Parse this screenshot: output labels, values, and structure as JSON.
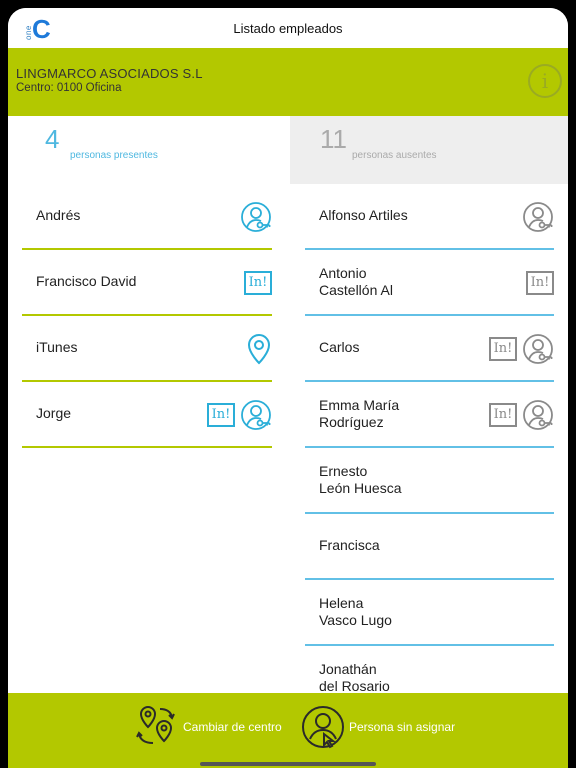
{
  "nav": {
    "title": "Listado empleados",
    "logo_small": "one",
    "logo_big": "C"
  },
  "company": {
    "name": "LINGMARCO ASOCIADOS S.L",
    "center": "Centro: 0100 Oficina",
    "info_icon": "i"
  },
  "tabs": {
    "present": {
      "count": "4",
      "label": "personas presentes"
    },
    "absent": {
      "count": "11",
      "label": "personas ausentes"
    }
  },
  "present": [
    {
      "name": "Andrés",
      "icons": [
        "person-key-icon"
      ]
    },
    {
      "name": "Francisco David",
      "icons": [
        "in-stamp-icon"
      ]
    },
    {
      "name": "iTunes",
      "icons": [
        "location-pin-icon"
      ]
    },
    {
      "name": "Jorge",
      "icons": [
        "in-stamp-icon",
        "person-key-icon"
      ]
    }
  ],
  "absent": [
    {
      "name": "Alfonso Artiles",
      "icons": [
        "person-key-icon"
      ]
    },
    {
      "name": "Antonio\nCastellón Al",
      "icons": [
        "in-stamp-icon"
      ]
    },
    {
      "name": "Carlos",
      "icons": [
        "in-stamp-icon",
        "person-key-icon"
      ]
    },
    {
      "name": "Emma María\nRodríguez",
      "icons": [
        "in-stamp-icon",
        "person-key-icon"
      ]
    },
    {
      "name": "Ernesto\nLeón Huesca",
      "icons": []
    },
    {
      "name": "Francisca",
      "icons": []
    },
    {
      "name": "Helena\nVasco Lugo",
      "icons": []
    },
    {
      "name": "Jonathán\ndel Rosario",
      "icons": []
    }
  ],
  "stamp_text": "In!",
  "bottom": {
    "change_center": "Cambiar de centro",
    "unassigned": "Persona sin asignar"
  },
  "colors": {
    "accent": "#b3c800",
    "present_blue": "#2aaed8",
    "absent_gray": "#8a8a8a",
    "divider_blue": "#62c0e6"
  }
}
